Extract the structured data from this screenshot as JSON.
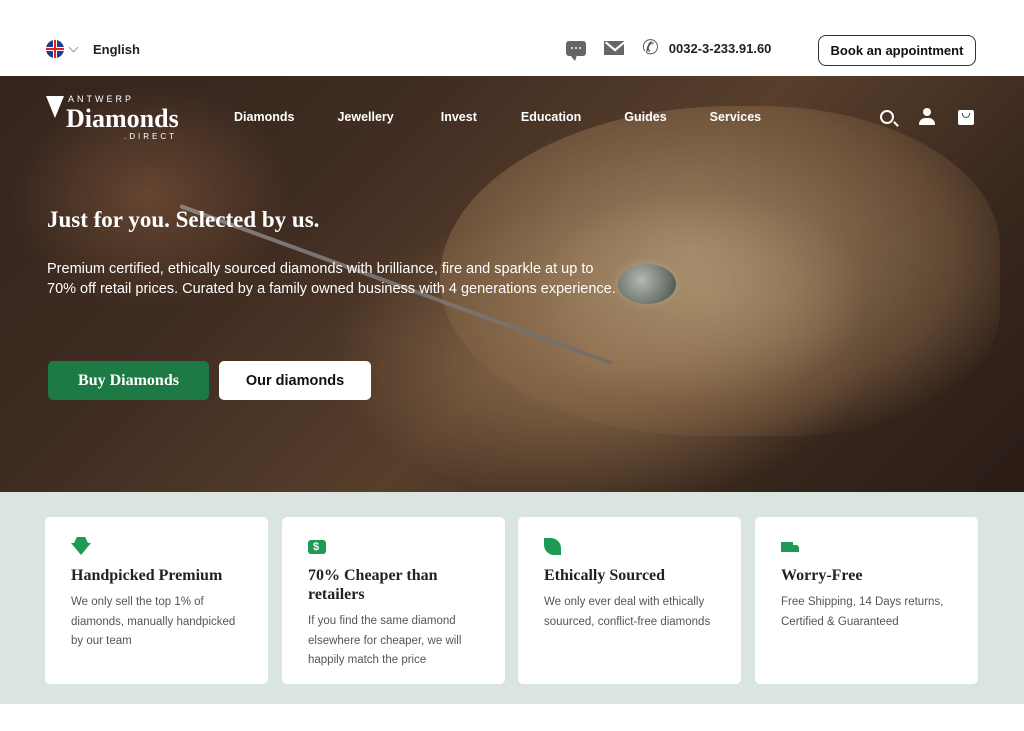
{
  "topbar": {
    "language": "English",
    "phone": "0032-3-233.91.60",
    "book_label": "Book an appointment"
  },
  "logo": {
    "top": "ANTWERP",
    "main": "Diamonds",
    "sub": ".DIRECT"
  },
  "nav": {
    "items": [
      {
        "label": "Diamonds"
      },
      {
        "label": "Jewellery"
      },
      {
        "label": "Invest"
      },
      {
        "label": "Education"
      },
      {
        "label": "Guides"
      },
      {
        "label": "Services"
      }
    ]
  },
  "hero": {
    "title": "Just for you. Selected by us.",
    "text": "Premium certified, ethically sourced diamonds with brilliance, fire and sparkle at up to 70% off retail prices. Curated by a family owned business with 4 generations experience.",
    "primary_button": "Buy Diamonds",
    "secondary_button": "Our diamonds"
  },
  "features": [
    {
      "icon": "diamond-icon",
      "title": "Handpicked Premium",
      "text": "We only sell the top 1% of diamonds, manually handpicked by our team"
    },
    {
      "icon": "money-icon",
      "title": "70% Cheaper than retailers",
      "text": "If you find the same diamond elsewhere for cheaper, we will happily match the price"
    },
    {
      "icon": "leaf-icon",
      "title": "Ethically Sourced",
      "text": "We only ever deal with ethically souurced, conflict-free diamonds"
    },
    {
      "icon": "truck-icon",
      "title": "Worry-Free",
      "text": "Free Shipping, 14 Days returns, Certified & Guaranteed"
    }
  ],
  "colors": {
    "accent_green": "#1e7a45",
    "feature_bg": "#dbe5df"
  }
}
